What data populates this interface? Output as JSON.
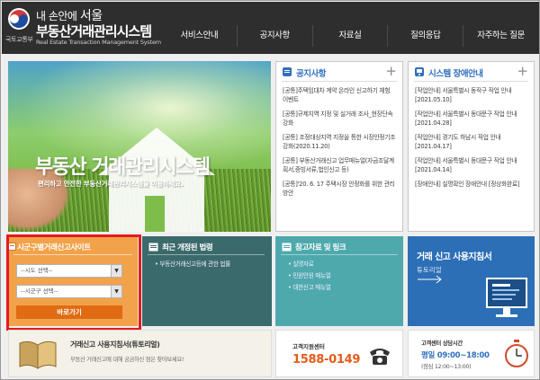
{
  "header": {
    "slogan_prefix": "내 손안에",
    "slogan_strong": "서울",
    "title": "부동산거래관리시스템",
    "subtitle": "Real Estate Transaction Management System",
    "ministry": "국토교통부",
    "nav": [
      "서비스안내",
      "공지사항",
      "자료실",
      "질의응답",
      "자주하는 질문"
    ]
  },
  "hero": {
    "title": "부동산 거래관리시스템",
    "subtitle": "편리하고 안전한 부동산거래관리시스템을 이용하세요."
  },
  "notice": {
    "title": "공지사항",
    "items": [
      "[공통]주택임대차 계약 온라인 신고하기 체험 이벤트",
      "[공통]규제지역 지정 및 실거래 조사_현장단속 강화",
      "[공통] 조정대상지역 지정을 통한 시장안정기조 강화(2020.11.20)",
      "[공통] 부동산거래신고 업무매뉴얼(자금조달계획서,증빙서류,법인신고 등)",
      "[공통]'20. 6. 17 주택시장 안정화를 위한 관리방안"
    ]
  },
  "outage": {
    "title": "시스템 장애안내",
    "items": [
      "[작업안내] 서울특별시 동작구 작업 안내[2021.05.10]",
      "[작업안내] 서울특별시 동대문구 작업 안내[2021.04.28]",
      "[작업안내] 경기도 하남시 작업 안내[2021.04.17]",
      "[작업안내] 서울특별시 동대문구 작업 안내[2021.04.14]",
      "[장애안내] 실명확인 장애안내 [정상화완료]"
    ]
  },
  "search": {
    "title": "시군구별거래신고사이트",
    "sido_placeholder": "--시도 선택--",
    "sigungu_placeholder": "--시군구 선택--",
    "go_label": "바로가기"
  },
  "law": {
    "title": "최근 개정된 법령",
    "links": [
      "부동산거래신고등에 관한 법률"
    ]
  },
  "reference": {
    "title": "참고자료 및 링크",
    "links": [
      "실명자료",
      "민원안원 매뉴얼",
      "대한신고 매뉴얼"
    ]
  },
  "guide": {
    "title": "거래 신고 사용지침서",
    "subtitle": "튜토리얼"
  },
  "tutorial": {
    "title": "거래신고 사용지침서(튜토리얼)",
    "subtitle": "부동산 거래신고에 대해 궁금하신 점은 찾아보세요!"
  },
  "call": {
    "label": "고객지원센터",
    "number": "1588-0149"
  },
  "hours": {
    "label": "고객센터 상담시간",
    "main": "평일 09:00~18:00",
    "lunch": "(점심 12:00~13:00)"
  },
  "colors": {
    "header_bg": "#2e2e2e",
    "search_tile": "#f2a24a",
    "highlight": "#e31b1b",
    "law_tile": "#3b6a6c",
    "ref_tile": "#4ea9ad",
    "guide_tile": "#2d6fb6",
    "call_number": "#e35b1a",
    "accent_blue": "#2f6fbf"
  }
}
